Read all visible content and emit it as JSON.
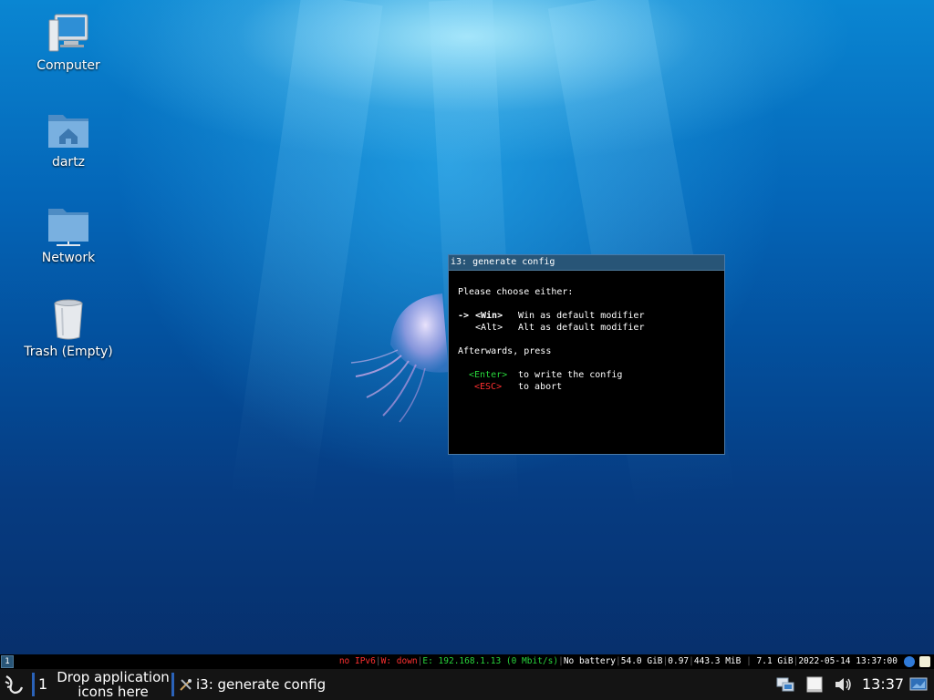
{
  "desktop": {
    "icons": [
      {
        "label": "Computer",
        "icon": "computer-icon"
      },
      {
        "label": "dartz",
        "icon": "home-folder-icon"
      },
      {
        "label": "Network",
        "icon": "network-folder-icon"
      },
      {
        "label": "Trash (Empty)",
        "icon": "trash-icon"
      }
    ]
  },
  "dialog": {
    "title": "i3: generate config",
    "prompt": "Please choose either:",
    "options": [
      {
        "arrow": "->",
        "key": "<Win>",
        "desc": "Win as default modifier"
      },
      {
        "arrow": "",
        "key": "<Alt>",
        "desc": "Alt as default modifier"
      }
    ],
    "afterwards": "Afterwards, press",
    "actions": [
      {
        "key": "<Enter>",
        "desc": "to write the config"
      },
      {
        "key": "<ESC>",
        "desc": "to abort"
      }
    ]
  },
  "i3bar": {
    "workspace": "1",
    "status": {
      "ipv6": "no IPv6",
      "wireless": "W: down",
      "ethernet": "E: 192.168.1.13 (0 Mbit/s)",
      "battery": "No battery",
      "disk": "54.0 GiB",
      "load": "0.97",
      "memory": "443.3 MiB",
      "memory_total": "7.1 GiB",
      "datetime": "2022-05-14 13:37:00"
    },
    "colors": {
      "good": "#28d63c",
      "bad": "#ff3030",
      "bar_bg": "#000000",
      "focused_ws": "#285577"
    }
  },
  "panel": {
    "desktop_number": "1",
    "launch_bar_text": "Drop application icons here",
    "task_label": "i3: generate config",
    "clock": "13:37",
    "tray_icons": [
      "network-icon",
      "drive-icon",
      "volume-icon",
      "desktop-icon"
    ]
  }
}
